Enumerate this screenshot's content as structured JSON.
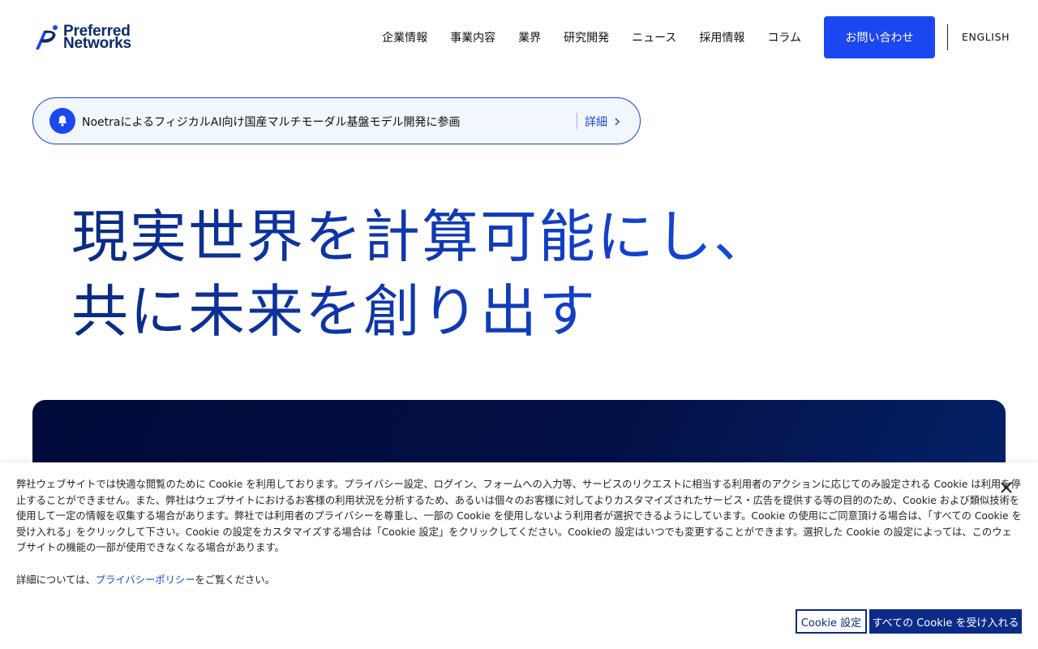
{
  "brand": {
    "line1": "Preferred",
    "line2": "Networks",
    "accent": "#1a47f0",
    "dark": "#0c2a6b"
  },
  "nav": {
    "items": [
      "企業情報",
      "事業内容",
      "業界",
      "研究開発",
      "ニュース",
      "採用情報",
      "コラム"
    ],
    "contact_label": "お問い合わせ",
    "lang_label": "ENGLISH"
  },
  "news": {
    "icon": "bell-icon",
    "text": "NoetraによるフィジカルAI向け国産マルチモーダル基盤モデル開発に参画",
    "more_label": "詳細"
  },
  "hero": {
    "line1": "現実世界を計算可能にし、",
    "line2": "共に未来を創り出す"
  },
  "cookie": {
    "body": "弊社ウェブサイトでは快適な閲覧のために Cookie を利用しております。プライバシー設定、ログイン、フォームへの入力等、サービスのリクエストに相当する利用者のアクションに応じてのみ設定される Cookie は利用を停止することができません。また、弊社はウェブサイトにおけるお客様の利用状況を分析するため、あるいは個々のお客様に対してよりカスタマイズされたサービス・広告を提供する等の目的のため、Cookie および類似技術を使用して一定の情報を収集する場合があります。弊社では利用者のプライバシーを尊重し、一部の Cookie を使用しないよう利用者が選択できるようにしています。Cookie の使用にご同意頂ける場合は、「すべての Cookie を受け入れる」をクリックして下さい。Cookie の設定をカスタマイズする場合は「Cookie 設定」をクリックしてください。Cookieの 設定はいつでも変更することができます。選択した Cookie の設定によっては、このウェブサイトの機能の一部が使用できなくなる場合があります。",
    "detail_prefix": "詳細については、",
    "policy_link": "プライバシーポリシー",
    "detail_suffix": "をご覧ください。",
    "settings_label": "Cookie 設定",
    "accept_label": "すべての Cookie を受け入れる"
  }
}
